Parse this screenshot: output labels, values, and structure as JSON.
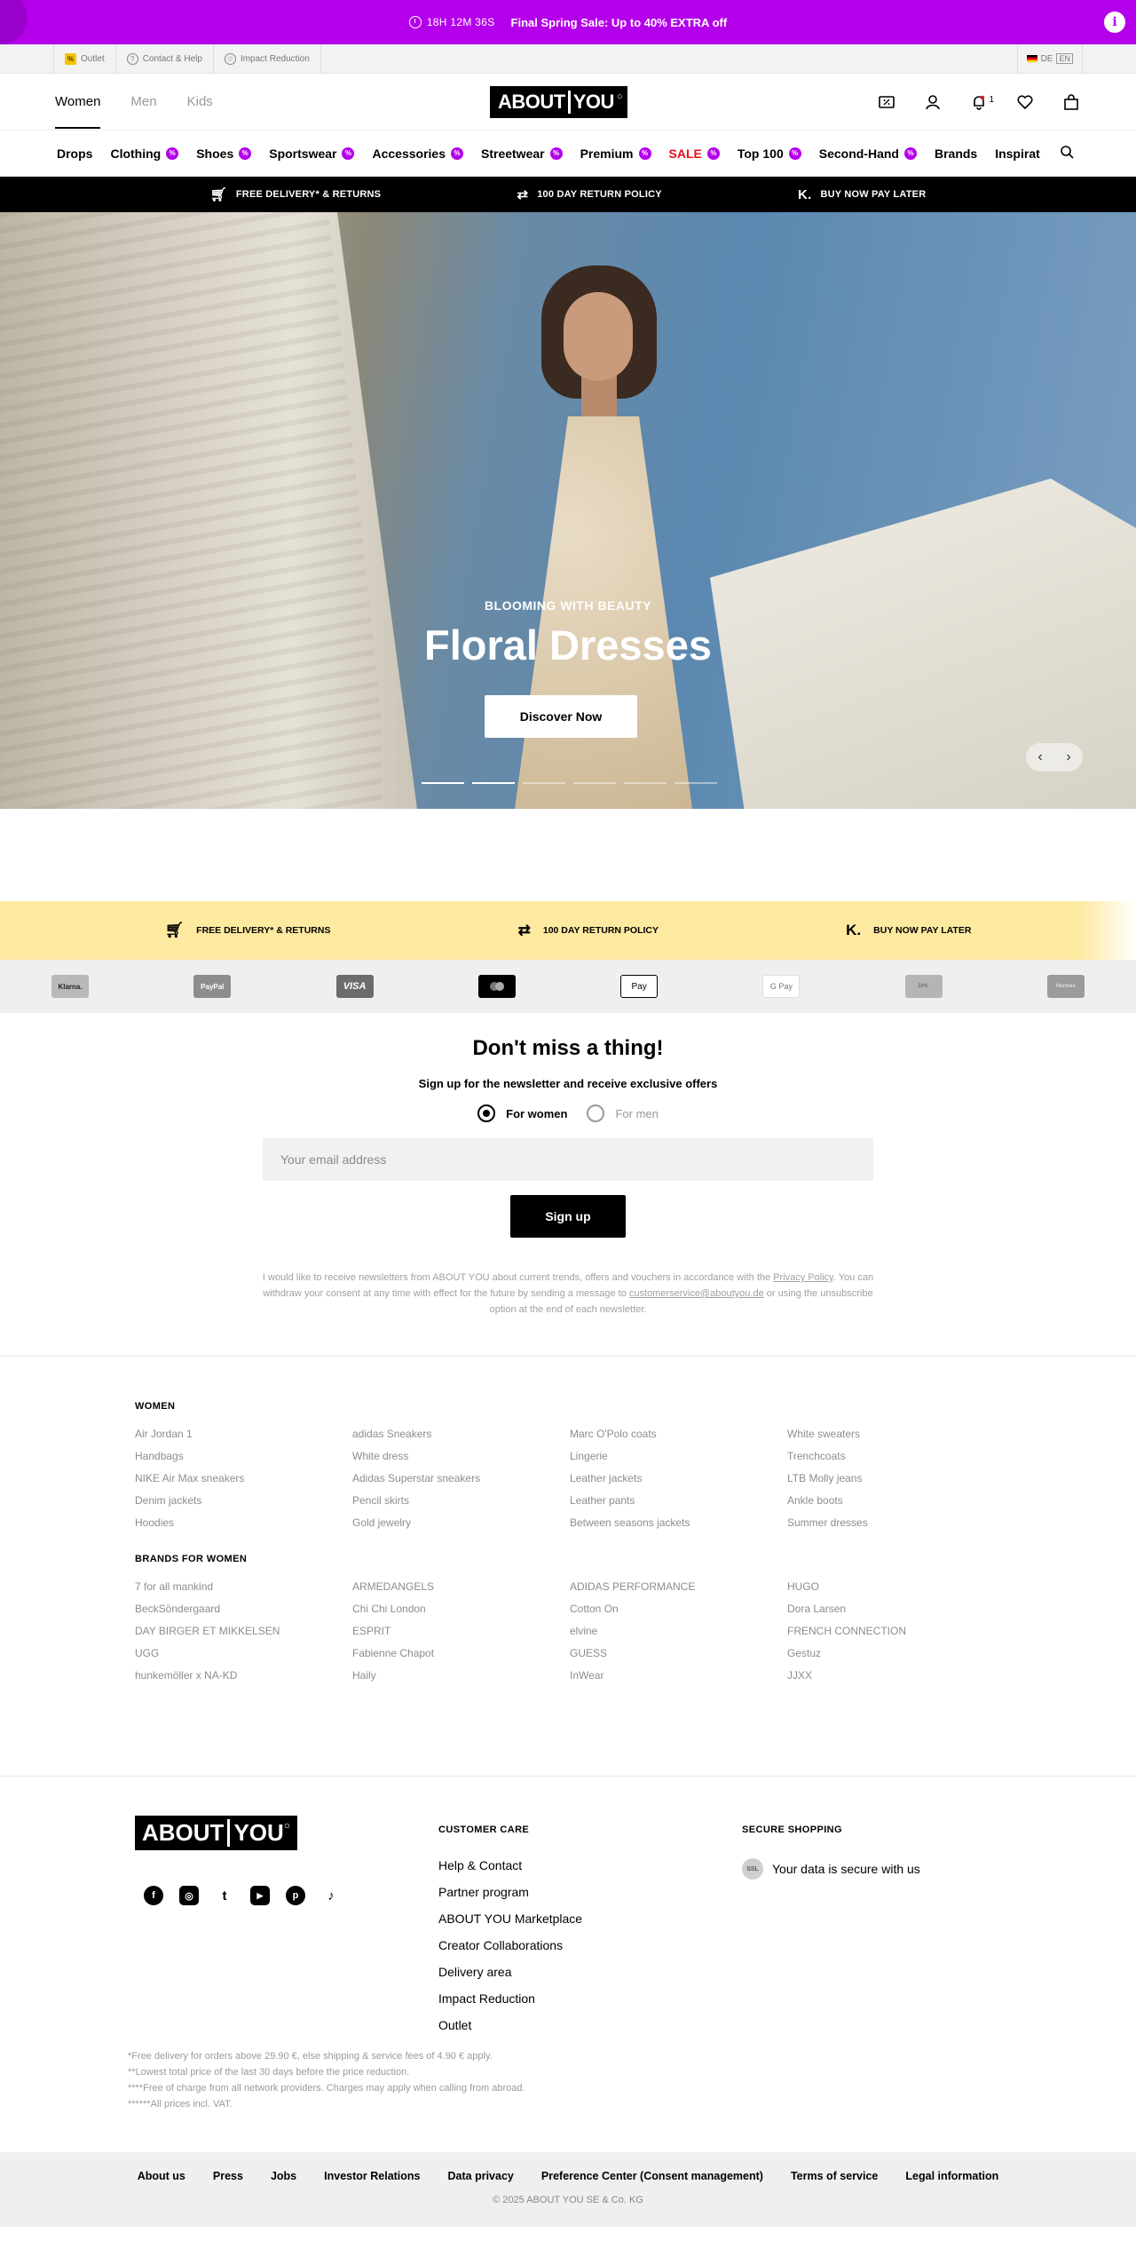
{
  "promo": {
    "timer": "18H 12M 36S",
    "message": "Final Spring Sale: Up to 40% EXTRA off",
    "info": "i"
  },
  "util": {
    "outlet": "Outlet",
    "contact": "Contact & Help",
    "impact": "Impact Reduction",
    "lang_de": "DE",
    "lang_en": "EN"
  },
  "header": {
    "women": "Women",
    "men": "Men",
    "kids": "Kids",
    "logo_a": "ABOUT",
    "logo_b": "YOU",
    "notif_count": "1"
  },
  "nav": {
    "items": [
      "Drops",
      "Clothing",
      "Shoes",
      "Sportswear",
      "Accessories",
      "Streetwear",
      "Premium",
      "SALE",
      "Top 100",
      "Second-Hand",
      "Brands",
      "Inspirat"
    ]
  },
  "usp": {
    "delivery": "FREE DELIVERY* & RETURNS",
    "returns": "100 DAY RETURN POLICY",
    "bnpl": "BUY NOW PAY LATER"
  },
  "hero": {
    "kicker": "BLOOMING WITH BEAUTY",
    "title": "Floral Dresses",
    "cta": "Discover Now"
  },
  "payments": [
    "Klarna.",
    "PayPal",
    "VISA",
    "mastercard",
    "Pay",
    "G Pay",
    "DHL",
    "Hermes"
  ],
  "newsletter": {
    "title": "Don't miss a thing!",
    "subtitle": "Sign up for the newsletter and receive exclusive offers",
    "for_women": "For women",
    "for_men": "For men",
    "email_placeholder": "Your email address",
    "signup": "Sign up",
    "legal_1": "I would like to receive newsletters from ABOUT YOU about current trends, offers and vouchers in accordance with the",
    "privacy": "Privacy Policy",
    "legal_2": ". You can withdraw your consent at any time with effect for the future by sending a message to",
    "email_link": "customerservice@aboutyou.de",
    "legal_3": " or using the unsubscribe option at the end of each newsletter."
  },
  "women_links": {
    "heading": "WOMEN",
    "items": [
      "Air Jordan 1",
      "adidas Sneakers",
      "Marc O'Polo coats",
      "White sweaters",
      "Handbags",
      "White dress",
      "Lingerie",
      "Trenchcoats",
      "NIKE Air Max sneakers",
      "Adidas Superstar sneakers",
      "Leather jackets",
      "LTB Molly jeans",
      "Denim jackets",
      "Pencil skirts",
      "Leather pants",
      "Ankle boots",
      "Hoodies",
      "Gold jewelry",
      "Between seasons jackets",
      "Summer dresses"
    ]
  },
  "brand_links": {
    "heading": "BRANDS FOR WOMEN",
    "items": [
      "7 for all mankind",
      "ARMEDANGELS",
      "ADIDAS PERFORMANCE",
      "HUGO",
      "BeckSöndergaard",
      "Chi Chi London",
      "Cotton On",
      "Dora Larsen",
      "DAY BIRGER ET MIKKELSEN",
      "ESPRIT",
      "elvine",
      "FRENCH CONNECTION",
      "UGG",
      "Fabienne Chapot",
      "GUESS",
      "Gestuz",
      "hunkemöller x NA-KD",
      "Haily",
      "InWear",
      "JJXX"
    ]
  },
  "footer": {
    "logo_a": "ABOUT",
    "logo_b": "YOU",
    "social": [
      "f",
      "◎",
      "t",
      "▶",
      "p",
      "♪"
    ],
    "care_heading": "CUSTOMER CARE",
    "care_links": [
      "Help & Contact",
      "Partner program",
      "ABOUT YOU Marketplace",
      "Creator Collaborations",
      "Delivery area",
      "Impact Reduction",
      "Outlet"
    ],
    "secure_heading": "SECURE SHOPPING",
    "secure_seal": "SSL",
    "secure_text": "Your data is secure with us",
    "notes": [
      "*Free delivery for orders above 29.90 €, else shipping & service fees of 4.90 € apply.",
      "**Lowest total price of the last 30 days before the price reduction.",
      "****Free of charge from all network providers. Charges may apply when calling from abroad.",
      "******All prices incl. VAT."
    ],
    "bottom_links": [
      "About us",
      "Press",
      "Jobs",
      "Investor Relations",
      "Data privacy",
      "Preference Center (Consent management)",
      "Terms of service",
      "Legal information"
    ],
    "copyright": "© 2025 ABOUT YOU SE & Co. KG"
  },
  "colors": {
    "accent": "#b400ea",
    "sale": "#e3101e",
    "usp_yellow": "#fde9a0"
  }
}
